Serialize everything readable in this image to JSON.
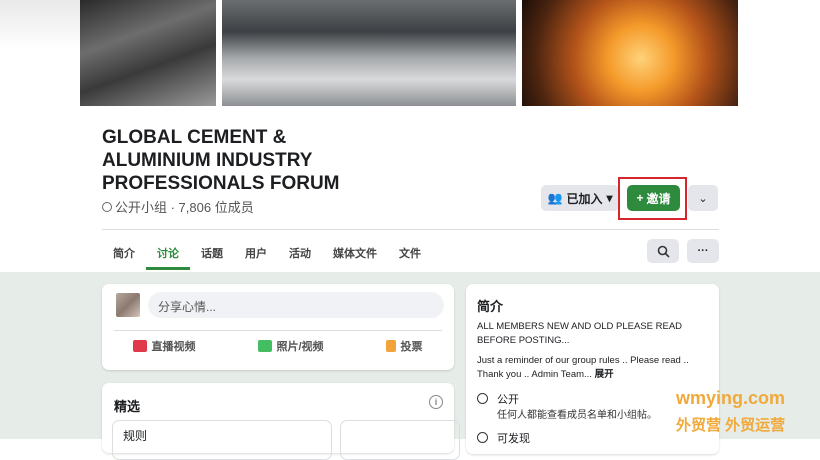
{
  "group": {
    "title": "GLOBAL CEMENT & ALUMINIUM INDUSTRY PROFESSIONALS FORUM",
    "meta": "公开小组 · 7,806 位成员"
  },
  "actions": {
    "joined_label": "已加入",
    "invite_label": "邀请",
    "invite_prefix": "+"
  },
  "tabs": [
    "简介",
    "讨论",
    "话题",
    "用户",
    "活动",
    "媒体文件",
    "文件"
  ],
  "active_tab": "讨论",
  "composer": {
    "placeholder": "分享心情...",
    "actions": [
      "直播视频",
      "照片/视频",
      "投票"
    ]
  },
  "featured": {
    "title": "精选",
    "first_item": "规则"
  },
  "about": {
    "title": "简介",
    "description_line1": "ALL MEMBERS NEW AND OLD PLEASE READ BEFORE POSTING...",
    "description_line2": "Just a reminder of our group rules .. Please read .. Thank you .. Admin Team...",
    "see_more": "展开",
    "public_title": "公开",
    "public_desc": "任何人都能查看成员名单和小组帖。",
    "visible_title": "可发现"
  },
  "watermark": {
    "line1": "wmying.com",
    "line2": "外贸营 外贸运营"
  },
  "colors": {
    "accent_green": "#2e8b3e",
    "highlight_red": "#d6252c",
    "watermark_orange": "#f0a93a"
  }
}
